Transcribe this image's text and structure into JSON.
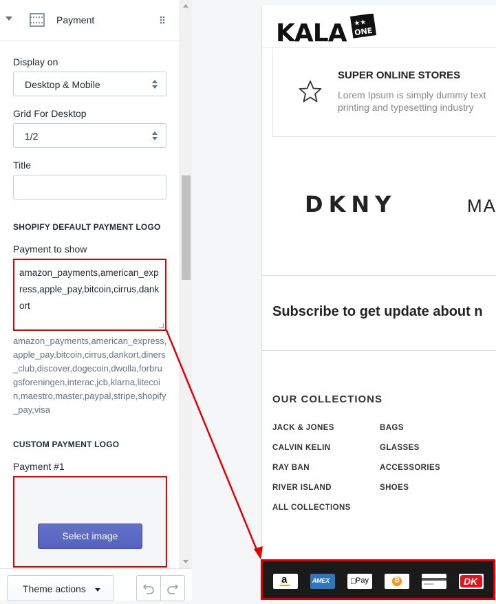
{
  "panel": {
    "section_title": "Payment",
    "display_on_label": "Display on",
    "display_on_value": "Desktop & Mobile",
    "grid_label": "Grid For Desktop",
    "grid_value": "1/2",
    "title_label": "Title",
    "title_value": "",
    "shopify_heading": "SHOPIFY DEFAULT PAYMENT LOGO",
    "payment_to_show_label": "Payment to show",
    "payment_to_show_value": "amazon_payments,american_express,apple_pay,bitcoin,cirrus,dankort",
    "payment_help": "amazon_payments,american_express,apple_pay,bitcoin,cirrus,dankort,diners_club,discover,dogecoin,dwolla,forbrugsforeningen,interac,jcb,klarna,litecoin,maestro,master,paypal,stripe,shopify_pay,visa",
    "custom_heading": "CUSTOM PAYMENT LOGO",
    "payment1_label": "Payment #1",
    "select_image_label": "Select image"
  },
  "footer": {
    "theme_actions_label": "Theme actions"
  },
  "preview": {
    "feature_title": "SUPER ONLINE STORES",
    "feature_text": "Lorem Ipsum is simply dummy text printing and typesetting industry",
    "brand_1": "DKNY",
    "brand_2": "MA",
    "subscribe": "Subscribe to get update about n",
    "collections_title": "OUR COLLECTIONS",
    "collections_col1": [
      "JACK & JONES",
      "CALVIN KELIN",
      "RAY BAN",
      "RIVER ISLAND",
      "ALL COLLECTIONS"
    ],
    "collections_col2": [
      "BAGS",
      "GLASSES",
      "ACCESSORIES",
      "SHOES"
    ],
    "payment_icons": [
      {
        "icon": "amazon-payments-icon",
        "text": "a"
      },
      {
        "icon": "amex-icon",
        "text": "AMEX"
      },
      {
        "icon": "apple-pay-icon",
        "text": "Pay"
      },
      {
        "icon": "bitcoin-icon",
        "text": "₿"
      },
      {
        "icon": "cirrus-icon",
        "text": ""
      },
      {
        "icon": "dankort-icon",
        "text": "DK"
      }
    ]
  },
  "colors": {
    "accent": "#5c6ac4",
    "highlight": "#e00000"
  }
}
